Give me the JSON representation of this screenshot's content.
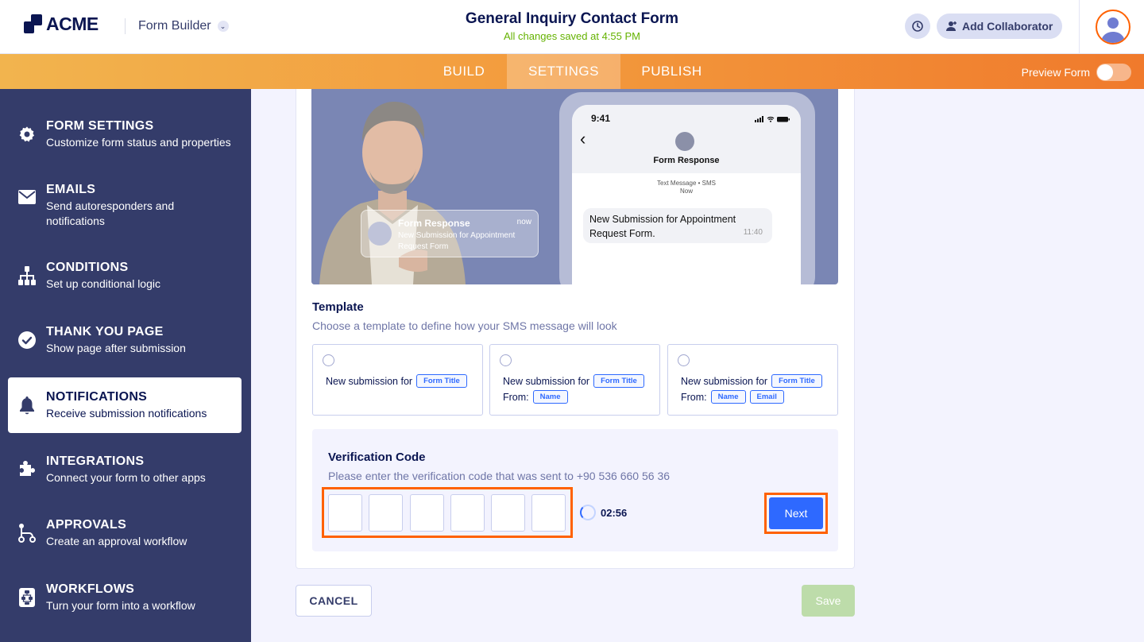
{
  "header": {
    "logo_text": "ACME",
    "app_name": "Form Builder",
    "form_title": "General Inquiry Contact Form",
    "save_status": "All changes saved at 4:55 PM",
    "add_collaborator": "Add Collaborator"
  },
  "nav": {
    "tabs": [
      {
        "label": "BUILD",
        "active": false
      },
      {
        "label": "SETTINGS",
        "active": true
      },
      {
        "label": "PUBLISH",
        "active": false
      }
    ],
    "preview_label": "Preview Form",
    "preview_enabled": false
  },
  "sidebar": {
    "items": [
      {
        "title": "FORM SETTINGS",
        "subtitle": "Customize form status and properties",
        "icon": "gear-icon"
      },
      {
        "title": "EMAILS",
        "subtitle": "Send autoresponders and notifications",
        "icon": "envelope-icon"
      },
      {
        "title": "CONDITIONS",
        "subtitle": "Set up conditional logic",
        "icon": "hierarchy-icon"
      },
      {
        "title": "THANK YOU PAGE",
        "subtitle": "Show page after submission",
        "icon": "check-circle-icon"
      },
      {
        "title": "NOTIFICATIONS",
        "subtitle": "Receive submission notifications",
        "icon": "bell-icon",
        "active": true
      },
      {
        "title": "INTEGRATIONS",
        "subtitle": "Connect your form to other apps",
        "icon": "puzzle-icon"
      },
      {
        "title": "APPROVALS",
        "subtitle": "Create an approval workflow",
        "icon": "approval-flow-icon"
      },
      {
        "title": "WORKFLOWS",
        "subtitle": "Turn your form into a workflow",
        "icon": "workflow-icon"
      }
    ]
  },
  "hero": {
    "notification": {
      "title": "Form Response",
      "time": "now",
      "body": "New Submission for Appointment Request Form"
    },
    "phone": {
      "clock": "9:41",
      "contact": "Form Response",
      "meta_line1": "Text Message • SMS",
      "meta_line2": "Now",
      "message": "New Submission for Appointment Request Form.",
      "message_time": "11:40"
    }
  },
  "template": {
    "title": "Template",
    "subtitle": "Choose a template to define how your SMS message will look",
    "options": [
      {
        "line1": "New submission for",
        "line1_tag": "Form Title"
      },
      {
        "line1": "New submission for",
        "line1_tag": "Form Title",
        "line2": "From:",
        "line2_tags": [
          "Name"
        ]
      },
      {
        "line1": "New submission for",
        "line1_tag": "Form Title",
        "line2": "From:",
        "line2_tags": [
          "Name",
          "Email"
        ]
      }
    ]
  },
  "verification": {
    "title": "Verification Code",
    "subtitle": "Please enter the verification code that was sent to +90 536 660 56 36",
    "code_digits": [
      "",
      "",
      "",
      "",
      "",
      ""
    ],
    "timer": "02:56",
    "next_label": "Next"
  },
  "footer": {
    "cancel_label": "CANCEL",
    "save_label": "Save"
  },
  "colors": {
    "accent_orange": "#ff6100",
    "primary_blue": "#2e69ff",
    "sidebar_bg": "#343c6a",
    "save_disabled": "#bddcaa",
    "saved_green": "#64b200"
  }
}
